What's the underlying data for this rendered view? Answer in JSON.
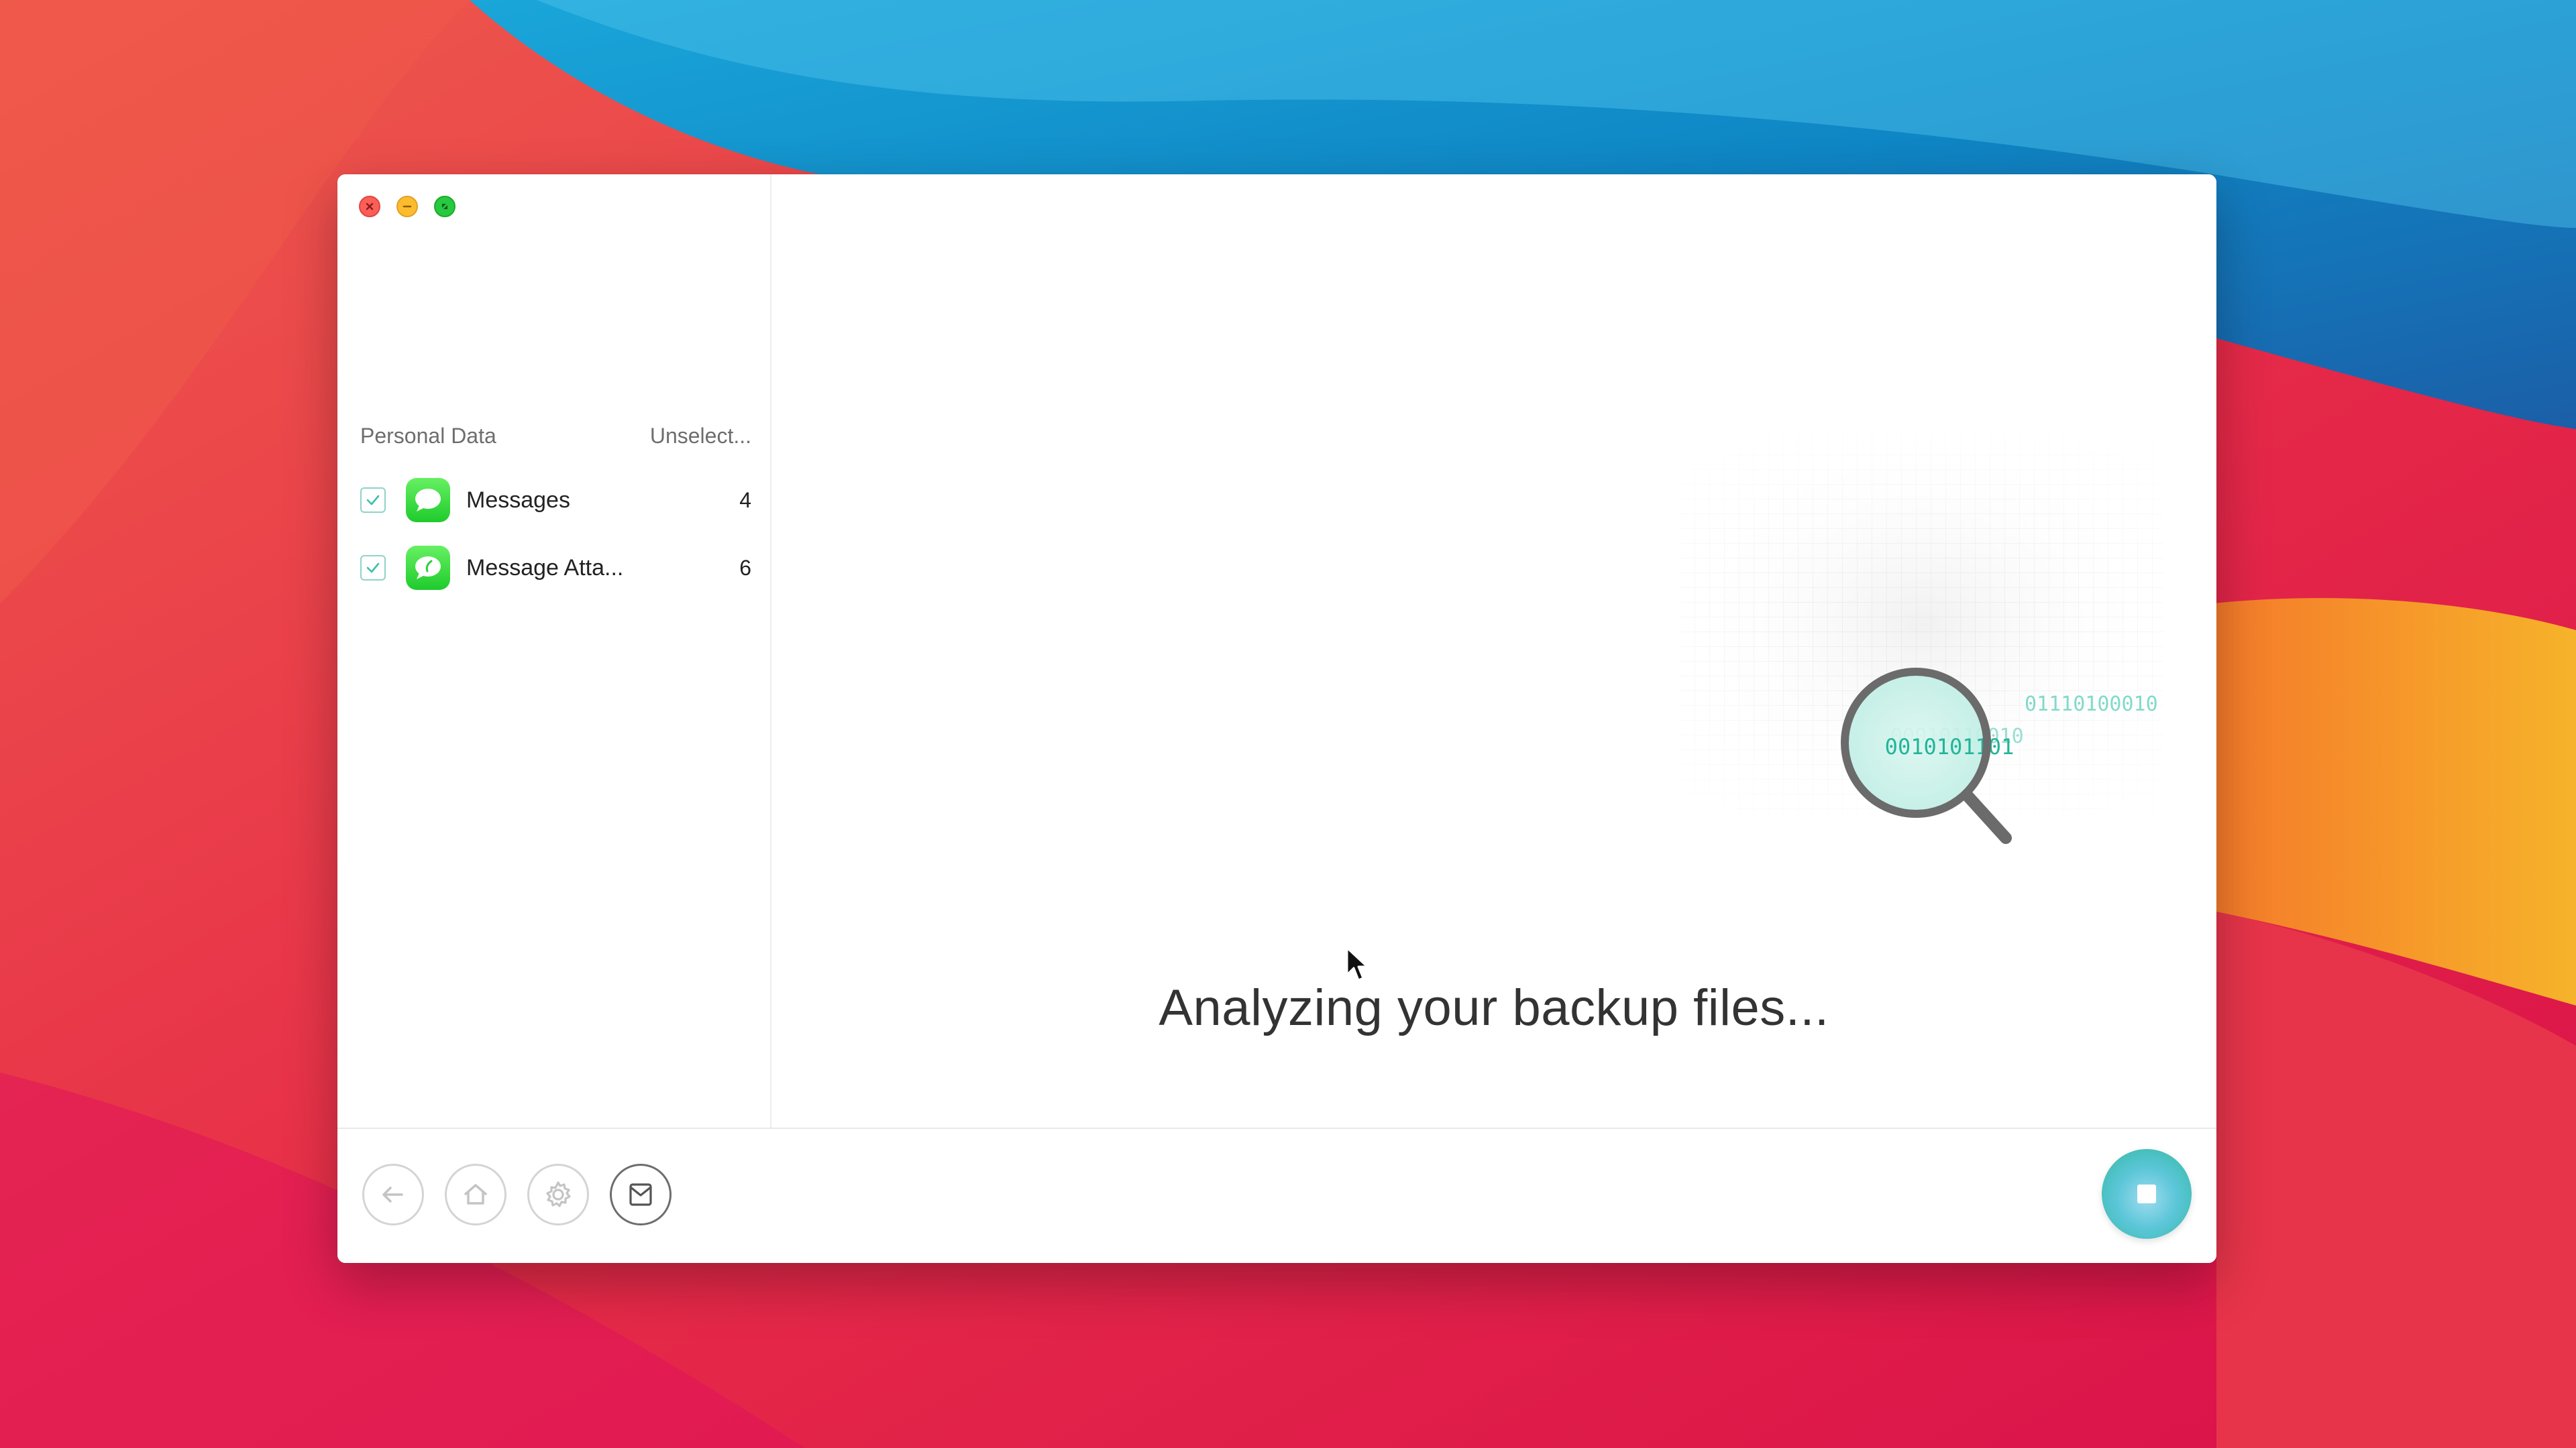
{
  "sidebar": {
    "header_title": "Personal Data",
    "unselect_label": "Unselect...",
    "items": [
      {
        "label": "Messages",
        "count": "4",
        "checked": true,
        "icon": "messages-app-icon"
      },
      {
        "label": "Message Atta...",
        "count": "6",
        "checked": true,
        "icon": "messages-app-icon"
      }
    ]
  },
  "main": {
    "status_text": "Analyzing your backup files...",
    "binary_lines": [
      "0010101101",
      "01110100010",
      "00010110010"
    ]
  },
  "footer": {
    "buttons": [
      "back-icon",
      "home-icon",
      "settings-icon",
      "mail-icon"
    ],
    "stop_button": "stop-icon"
  },
  "colors": {
    "accent": "#2ec4a6",
    "checkbox_border": "#8fd3c8",
    "app_icon_green": "#28d03a"
  }
}
